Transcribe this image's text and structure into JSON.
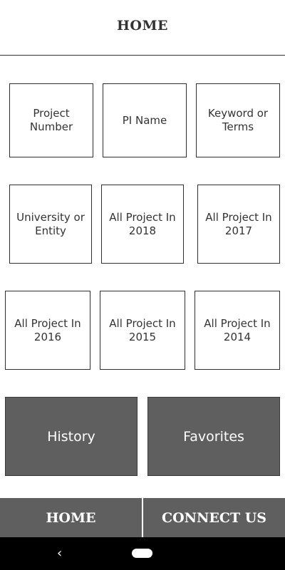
{
  "header": {
    "title": "HOME"
  },
  "tiles": [
    {
      "label": "Project Number"
    },
    {
      "label": "PI Name"
    },
    {
      "label": "Keyword or Terms"
    },
    {
      "label": "University or Entity"
    },
    {
      "label": "All Project In 2018"
    },
    {
      "label": "All Project In 2017"
    },
    {
      "label": "All Project In 2016"
    },
    {
      "label": "All Project In 2015"
    },
    {
      "label": "All Project In 2014"
    }
  ],
  "actions": {
    "history": "History",
    "favorites": "Favorites"
  },
  "footer": {
    "home": "HOME",
    "connect": "CONNECT US"
  },
  "navbar": {
    "back_icon": "‹"
  },
  "colors": {
    "dark_button": "#5f5f5f",
    "system_bar": "#000000"
  }
}
